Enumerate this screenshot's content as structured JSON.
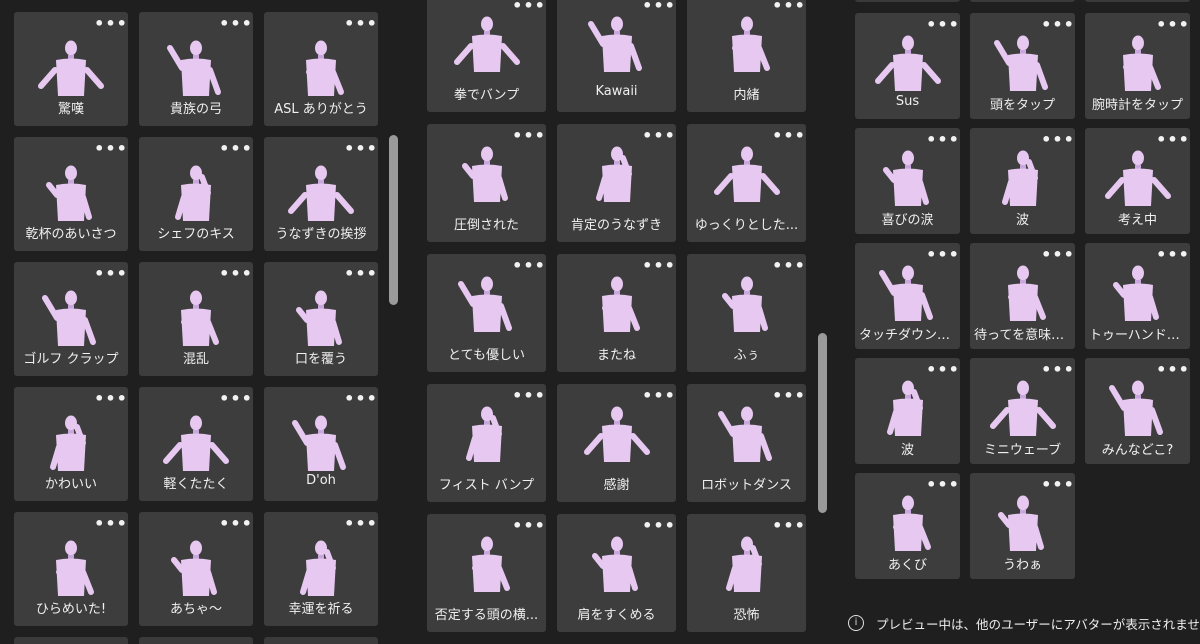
{
  "panel1": {
    "tiles": [
      {
        "label": "驚嘆",
        "icon": "avatar-arms-out-icon"
      },
      {
        "label": "貴族の弓",
        "icon": "avatar-bow-icon"
      },
      {
        "label": "ASL ありがとう",
        "icon": "avatar-sign-thanks-icon"
      },
      {
        "label": "乾杯のあいさつ",
        "icon": "avatar-toast-icon"
      },
      {
        "label": "シェフのキス",
        "icon": "avatar-chef-kiss-icon"
      },
      {
        "label": "うなずきの挨拶",
        "icon": "avatar-nod-icon"
      },
      {
        "label": "ゴルフ クラップ",
        "icon": "avatar-golf-clap-icon"
      },
      {
        "label": "混乱",
        "icon": "avatar-confused-icon"
      },
      {
        "label": "口を覆う",
        "icon": "avatar-cover-mouth-icon"
      },
      {
        "label": "かわいい",
        "icon": "avatar-cute-icon"
      },
      {
        "label": "軽くたたく",
        "icon": "avatar-dab-icon"
      },
      {
        "label": "D'oh",
        "icon": "avatar-doh-icon"
      },
      {
        "label": "ひらめいた!",
        "icon": "avatar-idea-icon"
      },
      {
        "label": "あちゃ～",
        "icon": "avatar-facepalm-icon"
      },
      {
        "label": "幸運を祈る",
        "icon": "avatar-fingers-crossed-icon"
      }
    ]
  },
  "panel2": {
    "tiles": [
      {
        "label": "拳でバンプ",
        "icon": "avatar-fist-pump-icon"
      },
      {
        "label": "Kawaii",
        "icon": "avatar-kawaii-icon"
      },
      {
        "label": "内緒",
        "icon": "avatar-shush-icon"
      },
      {
        "label": "圧倒された",
        "icon": "avatar-overwhelmed-icon"
      },
      {
        "label": "肯定のうなずき",
        "icon": "avatar-nod-yes-icon"
      },
      {
        "label": "ゆっくりとした...",
        "icon": "avatar-slow-nod-icon"
      },
      {
        "label": "とても優しい",
        "icon": "avatar-very-kind-icon"
      },
      {
        "label": "またね",
        "icon": "avatar-see-you-icon"
      },
      {
        "label": "ふぅ",
        "icon": "avatar-phew-icon"
      },
      {
        "label": "フィスト バンプ",
        "icon": "avatar-fist-bump-icon"
      },
      {
        "label": "感謝",
        "icon": "avatar-gratitude-icon"
      },
      {
        "label": "ロボットダンス",
        "icon": "avatar-robot-dance-icon"
      },
      {
        "label": "否定する頭の横...",
        "icon": "avatar-head-shake-icon"
      },
      {
        "label": "肩をすくめる",
        "icon": "avatar-shrug-icon"
      },
      {
        "label": "恐怖",
        "icon": "avatar-fear-icon"
      }
    ]
  },
  "panel3": {
    "tiles": [
      {
        "label": "Sus",
        "icon": "avatar-sus-icon"
      },
      {
        "label": "頭をタップ",
        "icon": "avatar-tap-head-icon"
      },
      {
        "label": "腕時計をタップ",
        "icon": "avatar-tap-watch-icon"
      },
      {
        "label": "喜びの涙",
        "icon": "avatar-tears-of-joy-icon"
      },
      {
        "label": "波",
        "icon": "avatar-wave-icon"
      },
      {
        "label": "考え中",
        "icon": "avatar-thinking-icon"
      },
      {
        "label": "タッチダウンセ...",
        "icon": "avatar-touchdown-icon"
      },
      {
        "label": "待ってを意味す...",
        "icon": "avatar-wait-icon"
      },
      {
        "label": "トゥーハンドウ...",
        "icon": "avatar-two-hand-wave-icon"
      },
      {
        "label": "波",
        "icon": "avatar-wave-small-icon"
      },
      {
        "label": "ミニウェーブ",
        "icon": "avatar-mini-wave-icon"
      },
      {
        "label": "みんなどこ?",
        "icon": "avatar-where-icon"
      },
      {
        "label": "あくび",
        "icon": "avatar-yawn-icon"
      },
      {
        "label": "うわぁ",
        "icon": "avatar-wow-icon"
      }
    ]
  },
  "more_glyph": "•••",
  "notice": {
    "icon": "i",
    "text": "プレビュー中は、他のユーザーにアバターが表示されません。"
  },
  "colors": {
    "background": "#1f1f1f",
    "tile": "#3d3d3d",
    "avatar": "#e6c8f0",
    "scrollbar": "#9a9a9a"
  }
}
